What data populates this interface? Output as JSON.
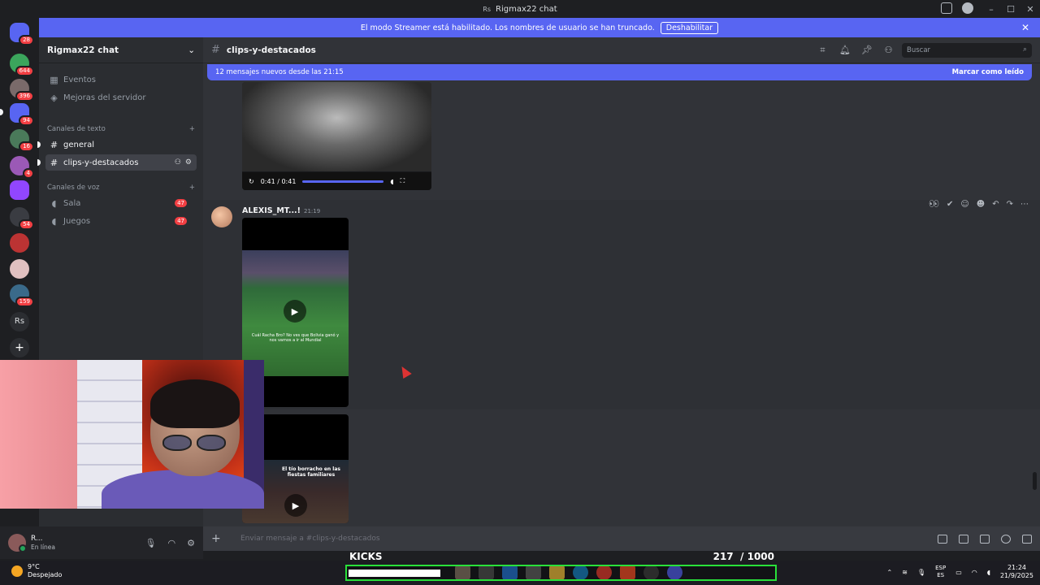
{
  "window": {
    "title": "Rigmax22 chat",
    "rs_label": "Rs"
  },
  "servers": [
    {
      "badge": "28",
      "color": "#5865f2"
    },
    {
      "badge": "644",
      "color": "#3ba55c"
    },
    {
      "badge": "396",
      "color": "#7a6a6a"
    },
    {
      "badge": "94",
      "color": "#5865f2"
    },
    {
      "badge": "16",
      "color": "#4a7a5a"
    },
    {
      "badge": "4",
      "color": "#9b59b6"
    },
    {
      "badge": "",
      "color": "#9146ff"
    },
    {
      "badge": "54",
      "color": "#2b2d31"
    },
    {
      "badge": "",
      "color": "#b33"
    },
    {
      "badge": "",
      "color": "#e0c0c0"
    },
    {
      "badge": "159",
      "color": "#3a6a8a"
    }
  ],
  "rs_server_label": "Rs",
  "banner": {
    "text": "El modo Streamer está habilitado. Los nombres de usuario se han truncado.",
    "button": "Deshabilitar"
  },
  "sidebar": {
    "server_name": "Rigmax22 chat",
    "events": "Eventos",
    "boost": "Mejoras del servidor",
    "text_category": "Canales de texto",
    "text_channels": [
      {
        "name": "general"
      },
      {
        "name": "clips-y-destacados"
      }
    ],
    "voice_category": "Canales de voz",
    "voice_channels": [
      {
        "name": "Sala",
        "badge": "47"
      },
      {
        "name": "Juegos",
        "badge": "47"
      }
    ]
  },
  "user": {
    "name": "R...",
    "status": "En línea"
  },
  "channel": {
    "name": "clips-y-destacados",
    "search_placeholder": "Buscar"
  },
  "new_messages": {
    "text": "12 mensajes nuevos desde las 21:15",
    "action": "Marcar como leído"
  },
  "video1": {
    "time": "0:41 / 0:41",
    "progress": 1.0
  },
  "message": {
    "author": "ALEXIS_MT...!",
    "time": "21:19",
    "video_caption": "Cuál Racha Bro? No ves que Bolivia ganó y nos vamos a ir al Mundial",
    "video2_caption": "El tío borracho en las fiestas familiares"
  },
  "composer": {
    "placeholder": "Enviar mensaje a #clips-y-destacados"
  },
  "kicks": {
    "label": "KICKS",
    "current": "217",
    "total": "/ 1000",
    "fraction": 0.217
  },
  "taskbar": {
    "temp": "9°C",
    "weather": "Despejado",
    "lang1": "ESP",
    "lang2": "ES",
    "time": "21:24",
    "date": "21/9/2025"
  }
}
